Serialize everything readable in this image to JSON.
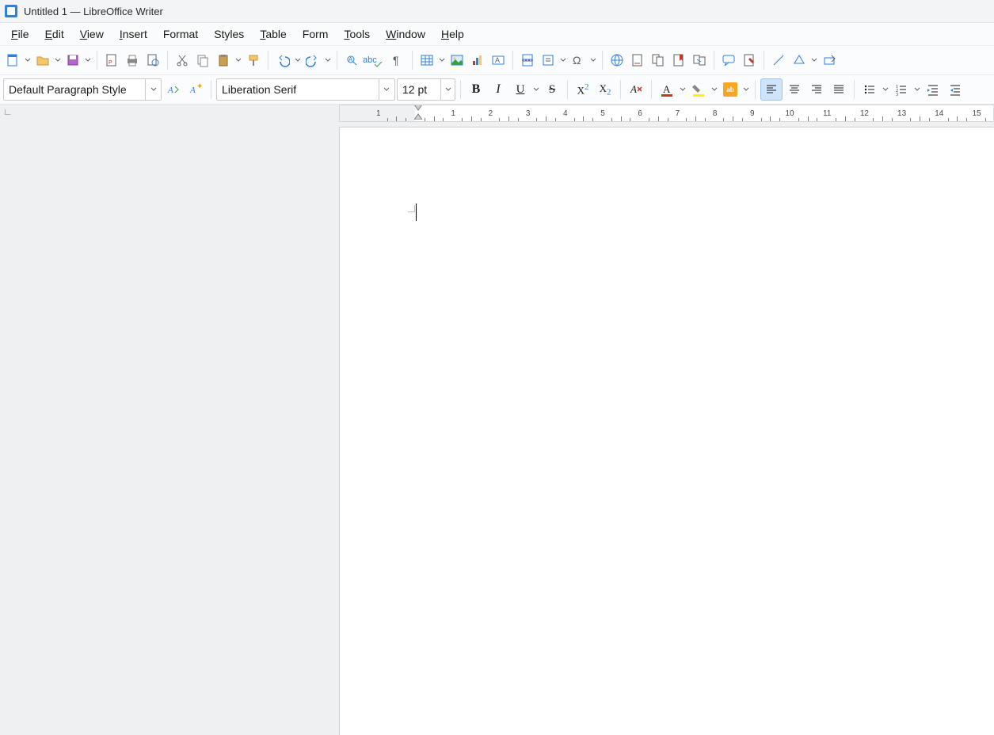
{
  "title": "Untitled 1 — LibreOffice Writer",
  "menu": {
    "file": "File",
    "edit": "Edit",
    "view": "View",
    "insert": "Insert",
    "format": "Format",
    "styles": "Styles",
    "table": "Table",
    "form": "Form",
    "tools": "Tools",
    "window": "Window",
    "help": "Help"
  },
  "toolbar2": {
    "paragraph_style": "Default Paragraph Style",
    "font_name": "Liberation Serif",
    "font_size": "12 pt",
    "spellcheck_label": "abc"
  },
  "ruler": {
    "marks": [
      "1",
      "",
      "1",
      "2",
      "3",
      "4",
      "5",
      "6",
      "7",
      "8",
      "9",
      "10",
      "11",
      "12",
      "13",
      "14",
      "15"
    ]
  }
}
